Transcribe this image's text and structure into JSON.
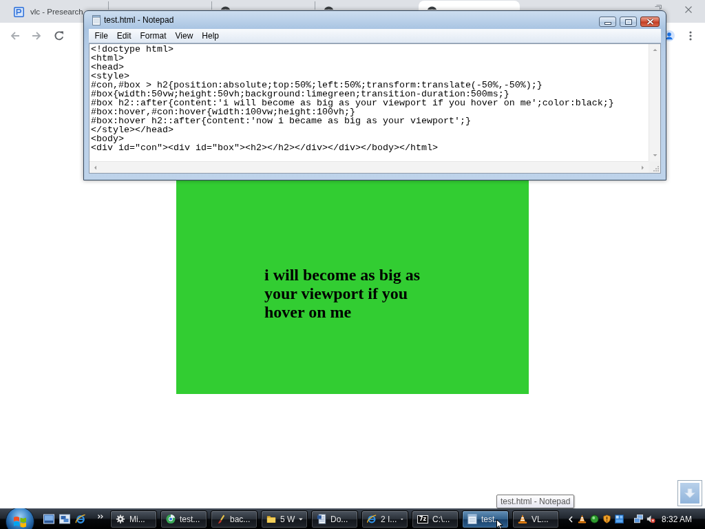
{
  "browser": {
    "tabs": [
      {
        "title": "vlc - Presearch",
        "kind": "logo",
        "selected": false
      },
      {
        "kind": "round",
        "selected": false
      },
      {
        "kind": "round",
        "selected": false
      },
      {
        "kind": "round",
        "selected": true
      }
    ],
    "nav": {
      "back": {
        "disabled": true
      },
      "forward": {
        "disabled": true
      }
    },
    "page": {
      "heading": "i will become as big as your viewport if you hover on me"
    }
  },
  "notepad": {
    "title": "test.html - Notepad",
    "menu": [
      "File",
      "Edit",
      "Format",
      "View",
      "Help"
    ],
    "lines": [
      "<!doctype html>",
      "<html>",
      "<head>",
      "<style>",
      "#con,#box > h2{position:absolute;top:50%;left:50%;transform:translate(-50%,-50%);}",
      "#box{width:50vw;height:50vh;background:limegreen;transition-duration:500ms;}",
      "#box h2::after{content:'i will become as big as your viewport if you hover on me';color:black;}",
      "#box:hover,#con:hover{width:100vw;height:100vh;}",
      "#box:hover h2::after{content:'now i became as big as your viewport';}",
      "</style></head>",
      "<body>",
      "<div id=\"con\"><div id=\"box\"><h2></h2></div></div></body></html>"
    ]
  },
  "taskbar": {
    "tasks": [
      {
        "label": "Mi...",
        "kind": "gear",
        "selected": false,
        "grouped": false
      },
      {
        "label": "test...",
        "kind": "round",
        "selected": false,
        "grouped": false
      },
      {
        "label": "bac...",
        "kind": "brush",
        "selected": false,
        "grouped": false
      },
      {
        "label": "5 W",
        "kind": "folder",
        "selected": false,
        "grouped": true
      },
      {
        "label": "Do...",
        "kind": "document",
        "selected": false,
        "grouped": false
      },
      {
        "label": "2 I...",
        "kind": "e_logo",
        "selected": false,
        "grouped": true
      },
      {
        "label": "C:\\...",
        "kind": "archive",
        "icon_text": "7z",
        "selected": false,
        "grouped": false
      },
      {
        "label": "test..",
        "kind": "notepad",
        "selected": true,
        "grouped": false
      },
      {
        "label": "VL...",
        "kind": "cone",
        "selected": false,
        "grouped": false
      }
    ],
    "clock": "8:32 AM"
  },
  "tooltip": "test.html - Notepad"
}
